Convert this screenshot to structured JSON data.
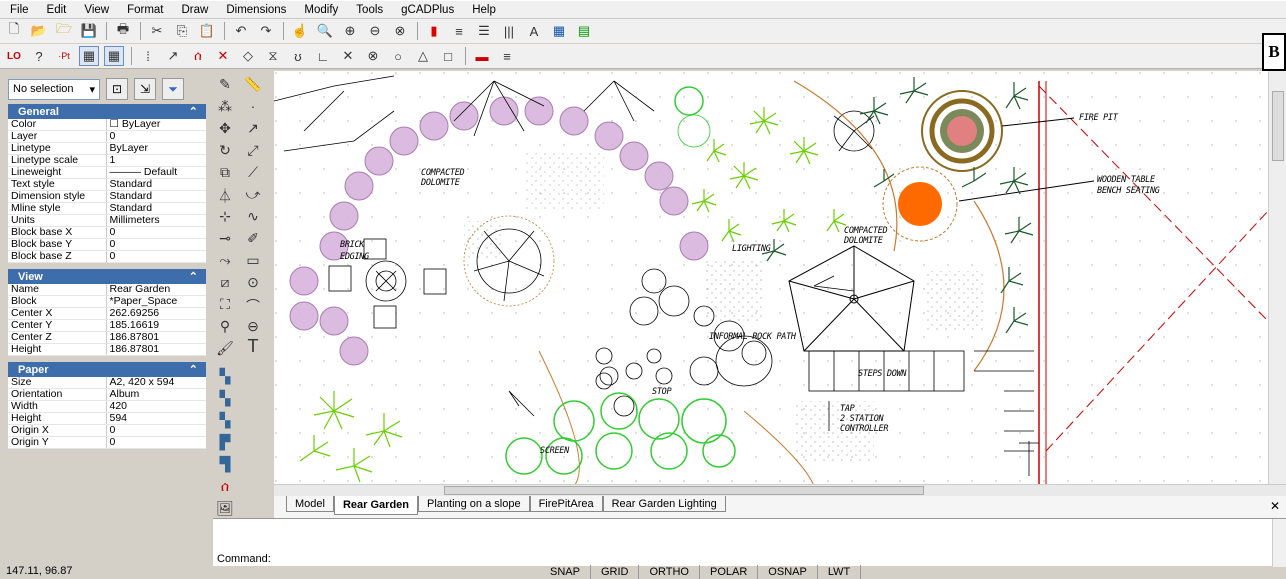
{
  "menu": [
    "File",
    "Edit",
    "View",
    "Format",
    "Draw",
    "Dimensions",
    "Modify",
    "Tools",
    "gCADPlus",
    "Help"
  ],
  "corner_label": "B",
  "selection": {
    "value": "No selection"
  },
  "general": {
    "title": "General",
    "rows": [
      {
        "k": "Color",
        "v": "☐ ByLayer"
      },
      {
        "k": "Layer",
        "v": "0"
      },
      {
        "k": "Linetype",
        "v": "ByLayer"
      },
      {
        "k": "Linetype scale",
        "v": "1"
      },
      {
        "k": "Lineweight",
        "v": "——— Default"
      },
      {
        "k": "Text style",
        "v": "Standard"
      },
      {
        "k": "Dimension style",
        "v": "Standard"
      },
      {
        "k": "Mline style",
        "v": "Standard"
      },
      {
        "k": "Units",
        "v": "Millimeters"
      },
      {
        "k": "Block base X",
        "v": "0"
      },
      {
        "k": "Block base Y",
        "v": "0"
      },
      {
        "k": "Block base Z",
        "v": "0"
      }
    ]
  },
  "view": {
    "title": "View",
    "rows": [
      {
        "k": "Name",
        "v": "Rear Garden"
      },
      {
        "k": "Block",
        "v": "*Paper_Space"
      },
      {
        "k": "Center X",
        "v": "262.69256"
      },
      {
        "k": "Center Y",
        "v": "185.16619"
      },
      {
        "k": "Center Z",
        "v": "186.87801"
      },
      {
        "k": "Height",
        "v": "186.87801"
      }
    ]
  },
  "paper": {
    "title": "Paper",
    "rows": [
      {
        "k": "Size",
        "v": "A2, 420 x 594"
      },
      {
        "k": "Orientation",
        "v": "Album"
      },
      {
        "k": "Width",
        "v": "420"
      },
      {
        "k": "Height",
        "v": "594"
      },
      {
        "k": "Origin X",
        "v": "0"
      },
      {
        "k": "Origin Y",
        "v": "0"
      }
    ]
  },
  "tabs": [
    "Model",
    "Rear Garden",
    "Planting on a slope",
    "FirePitArea",
    "Rear Garden Lighting"
  ],
  "active_tab": "Rear Garden",
  "command": {
    "label": "Command:"
  },
  "coords": "147.11, 96.87",
  "status_buttons": [
    "SNAP",
    "GRID",
    "ORTHO",
    "POLAR",
    "OSNAP",
    "LWT"
  ],
  "drawing_labels": {
    "fire_pit": "FIRE PIT",
    "bench_1": "WOODEN TABLE",
    "bench_2": "BENCH SEATING",
    "compacted_1a": "COMPACTED",
    "compacted_1b": "DOLOMITE",
    "compacted_2a": "COMPACTED",
    "compacted_2b": "DOLOMITE",
    "brick_1": "BRICK",
    "brick_2": "EDGING",
    "lighting": "LIGHTING",
    "rock_path": "INFORMAL ROCK PATH",
    "steps": "STEPS DOWN",
    "stop": "STOP",
    "tap_1": "TAP",
    "tap_2": "2 STATION",
    "tap_3": "CONTROLLER",
    "screen": "SCREEN"
  },
  "colors": {
    "accent": "#3d6daa",
    "fire": "#ff6a00",
    "hedge": "#d8b4dc",
    "plant": "#6ad000",
    "circle": "#33cc33",
    "boundary": "#cc0000"
  }
}
